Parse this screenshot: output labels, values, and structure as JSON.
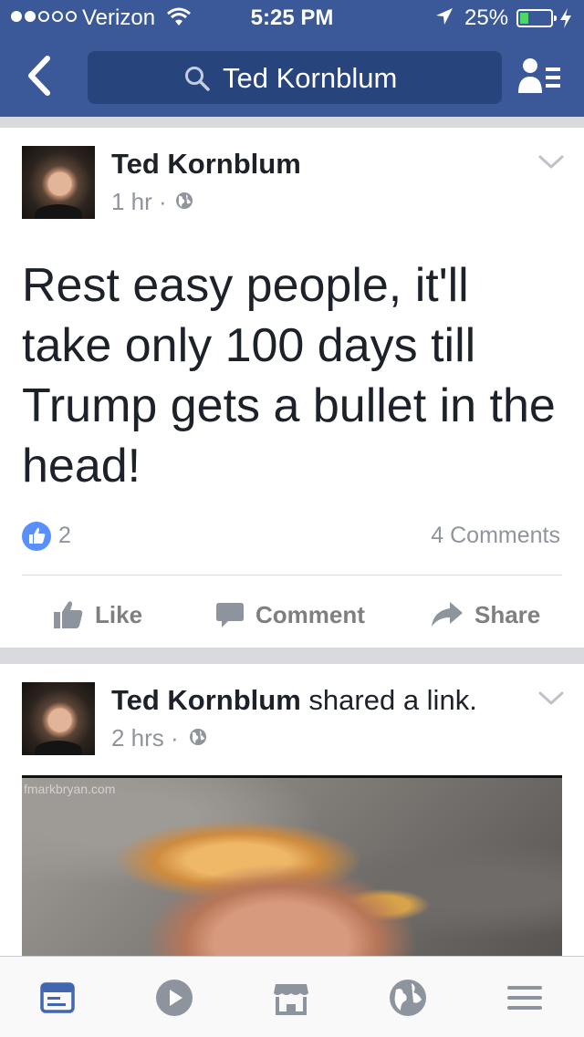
{
  "status_bar": {
    "carrier": "Verizon",
    "time": "5:25 PM",
    "battery": "25%",
    "battery_level": 0.25
  },
  "nav": {
    "search_text": "Ted Kornblum"
  },
  "posts": [
    {
      "author": "Ted Kornblum",
      "action": "",
      "time": "1 hr",
      "separator": "·",
      "text": "Rest easy people, it'll take only 100 days till Trump gets a bullet in the head!",
      "like_count": "2",
      "comments": "4 Comments",
      "actions": {
        "like": "Like",
        "comment": "Comment",
        "share": "Share"
      }
    },
    {
      "author": "Ted Kornblum",
      "action": "shared a link.",
      "time": "2 hrs",
      "separator": "·",
      "link_watermark": "fmarkbryan.com"
    }
  ],
  "tabs": [
    "news-feed-icon",
    "video-icon",
    "marketplace-icon",
    "notifications-globe-icon",
    "menu-icon"
  ],
  "colors": {
    "brand": "#3b5998",
    "search_bg": "#27447d",
    "active_tab": "#4267b2",
    "inactive_tab": "#8d949e",
    "like_blue": "#5890ff"
  }
}
